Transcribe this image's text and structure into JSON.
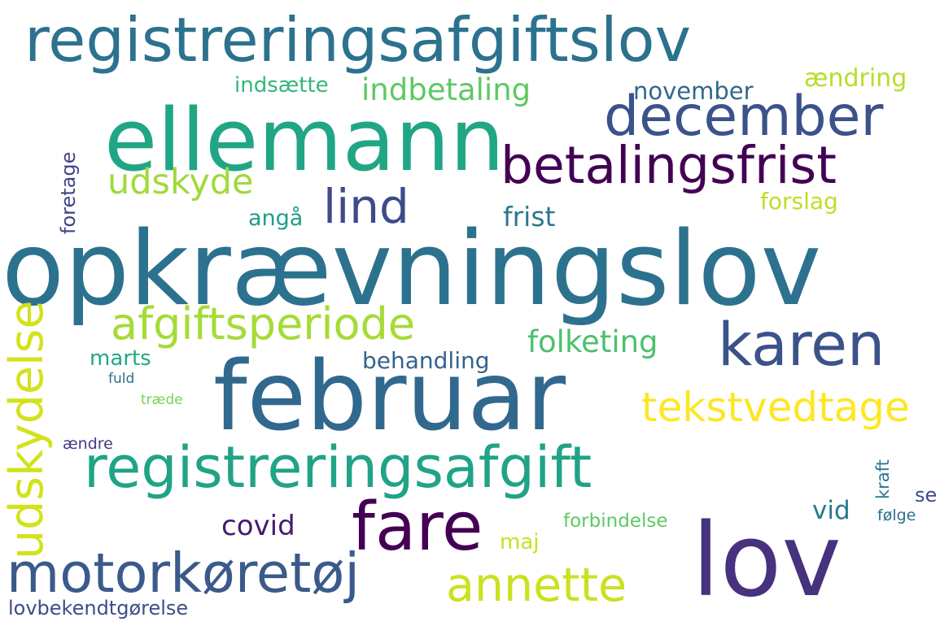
{
  "words": [
    {
      "id": "registreringsafgiftslov",
      "text": "registreringsafgiftslov",
      "color": "#2c728e"
    },
    {
      "id": "ellemann",
      "text": "ellemann",
      "color": "#21a685"
    },
    {
      "id": "december",
      "text": "december",
      "color": "#3b528b"
    },
    {
      "id": "betalingsfrist",
      "text": "betalingsfrist",
      "color": "#440154"
    },
    {
      "id": "indsaette",
      "text": "indsætte",
      "color": "#35b779"
    },
    {
      "id": "indbetaling",
      "text": "indbetaling",
      "color": "#5ec962"
    },
    {
      "id": "november",
      "text": "november",
      "color": "#31688e"
    },
    {
      "id": "aendring",
      "text": "ændring",
      "color": "#b5de2b"
    },
    {
      "id": "udskyde",
      "text": "udskyde",
      "color": "#a0da39"
    },
    {
      "id": "lind",
      "text": "lind",
      "color": "#3e4a89"
    },
    {
      "id": "anga",
      "text": "angå",
      "color": "#1f9e89"
    },
    {
      "id": "frist",
      "text": "frist",
      "color": "#2a788e"
    },
    {
      "id": "forslag",
      "text": "forslag",
      "color": "#bddf26"
    },
    {
      "id": "foretage",
      "text": "foretage",
      "color": "#414487"
    },
    {
      "id": "opkraevningslov",
      "text": "opkrævningslov",
      "color": "#2c728e"
    },
    {
      "id": "afgiftsperiode",
      "text": "afgiftsperiode",
      "color": "#a5db36"
    },
    {
      "id": "karen",
      "text": "karen",
      "color": "#3b528b"
    },
    {
      "id": "udskydelse",
      "text": "udskydelse",
      "color": "#d2e21b"
    },
    {
      "id": "folketing",
      "text": "folketing",
      "color": "#4ac16d"
    },
    {
      "id": "marts",
      "text": "marts",
      "color": "#22a884"
    },
    {
      "id": "behandling",
      "text": "behandling",
      "color": "#33638d"
    },
    {
      "id": "fuld",
      "text": "fuld",
      "color": "#2d708e"
    },
    {
      "id": "traede",
      "text": "træde",
      "color": "#7ad151"
    },
    {
      "id": "februar",
      "text": "februar",
      "color": "#31688e"
    },
    {
      "id": "tekstvedtage",
      "text": "tekstvedtage",
      "color": "#fde725"
    },
    {
      "id": "aendre",
      "text": "ændre",
      "color": "#453781"
    },
    {
      "id": "registreringsafgift",
      "text": "registreringsafgift",
      "color": "#20a386"
    },
    {
      "id": "kraft",
      "text": "kraft",
      "color": "#2a788e"
    },
    {
      "id": "se",
      "text": "se",
      "color": "#3e4989"
    },
    {
      "id": "vid",
      "text": "vid",
      "color": "#2a788e"
    },
    {
      "id": "fare",
      "text": "fare",
      "color": "#440154"
    },
    {
      "id": "covid",
      "text": "covid",
      "color": "#481a6c"
    },
    {
      "id": "forbindelse",
      "text": "forbindelse",
      "color": "#5ec962"
    },
    {
      "id": "folge",
      "text": "følge",
      "color": "#2e6f8e"
    },
    {
      "id": "maj",
      "text": "maj",
      "color": "#c8e020"
    },
    {
      "id": "lov",
      "text": "lov",
      "color": "#46327e"
    },
    {
      "id": "motorkoretoj",
      "text": "motorkøretøj",
      "color": "#3b5a8c"
    },
    {
      "id": "annette",
      "text": "annette",
      "color": "#cbe11e"
    },
    {
      "id": "lovbekendtgorelse",
      "text": "lovbekendtgørelse",
      "color": "#3d4e8a"
    }
  ]
}
